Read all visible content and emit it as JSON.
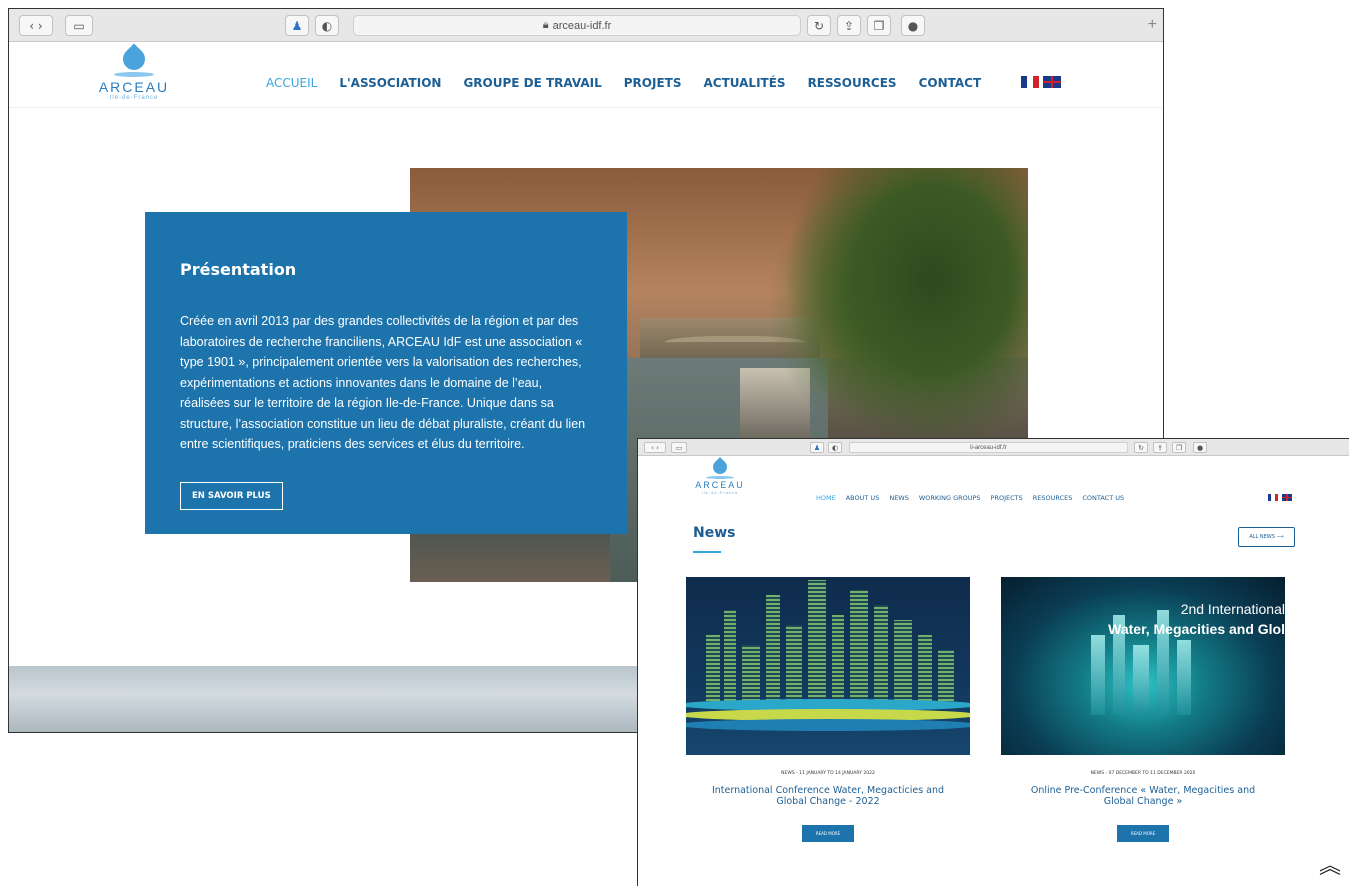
{
  "window1": {
    "url": "arceau-idf.fr",
    "logo": {
      "name": "ARCEAU",
      "sub": "Ile-de-France"
    },
    "nav": [
      "ACCUEIL",
      "L'ASSOCIATION",
      "GROUPE DE TRAVAIL",
      "PROJETS",
      "ACTUALITÉS",
      "RESSOURCES",
      "CONTACT"
    ],
    "active_nav": "ACCUEIL",
    "presentation": {
      "title": "Présentation",
      "text": "Créée en avril 2013 par des grandes collectivités de la région et par des laboratoires de recherche franciliens, ARCEAU IdF est une association « type 1901 », principalement orientée vers la valorisation des recherches, expérimentations et actions innovantes dans le domaine de l’eau, réalisées sur le territoire de la région Ile-de-France. Unique dans sa structure, l’association constitue un lieu de débat pluraliste, créant du lien entre scientifiques, praticiens des services et élus du territoire.",
      "button": "EN SAVOIR PLUS"
    }
  },
  "window2": {
    "url": "ii-arceau-idf.fr",
    "logo": {
      "name": "ARCEAU",
      "sub": "Ile-de-France"
    },
    "nav": [
      "HOME",
      "ABOUT US",
      "NEWS",
      "WORKING GROUPS",
      "PROJECTS",
      "RESOURCES",
      "CONTACT US"
    ],
    "active_nav": "HOME",
    "news_title": "News",
    "all_news": "ALL NEWS ⟶",
    "cards": [
      {
        "meta": "NEWS - 11 JANUARY TO 14 JANUARY 2022",
        "title": "International Conference Water, Megacticies and Global Change - 2022",
        "button": "READ MORE"
      },
      {
        "image_caption_1": "2nd International",
        "image_caption_2": "Water, Megacities and Glol",
        "meta": "NEWS - 07 DECEMBER TO 11 DECEMBER 2020",
        "title": "Online Pre-Conference « Water, Megacities and Global Change »",
        "button": "READ MORE"
      }
    ]
  },
  "colors": {
    "brand_blue": "#1d74ad",
    "nav_blue": "#1d5f94",
    "active_blue": "#3aa6e0"
  },
  "scroll_top_icon": "double-chevron-up-icon"
}
